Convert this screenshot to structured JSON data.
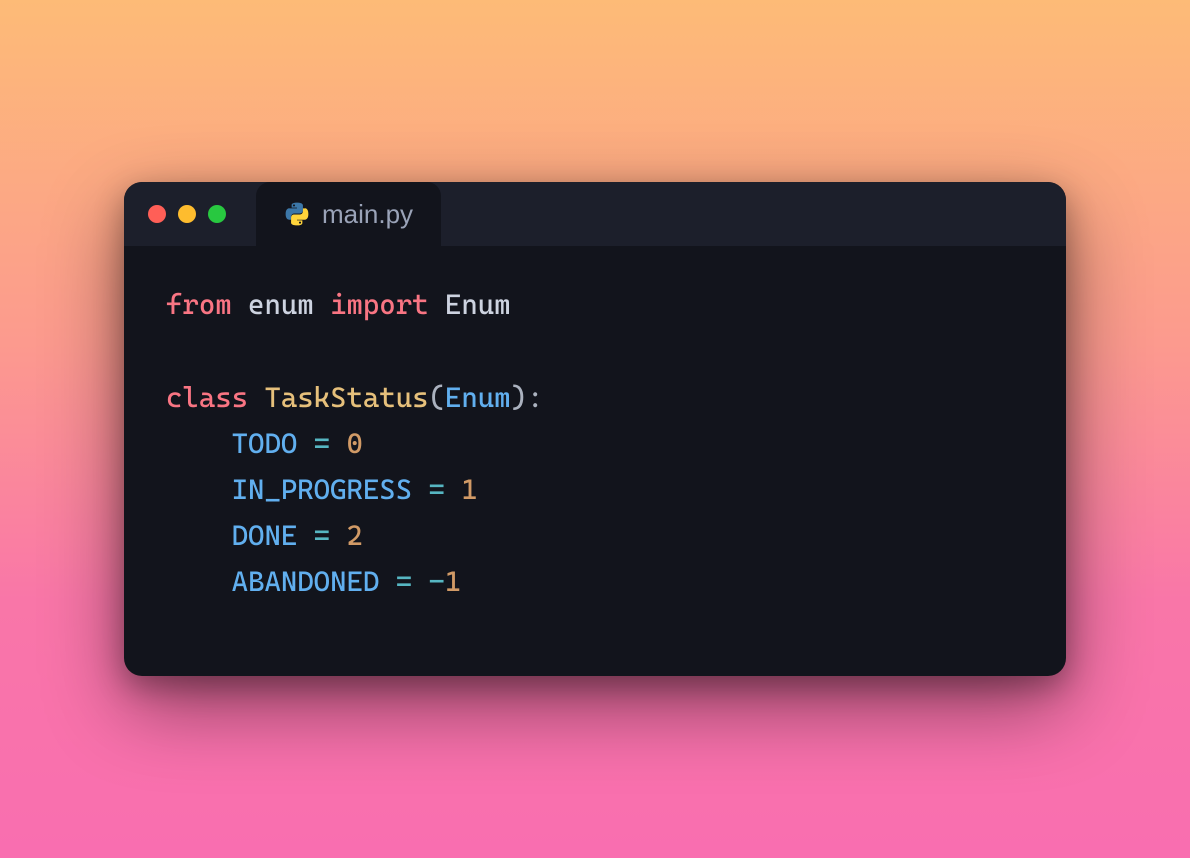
{
  "tab": {
    "filename": "main.py"
  },
  "code": {
    "kw_from": "from",
    "mod_enum": "enum",
    "kw_import": "import",
    "cls_enum": "Enum",
    "kw_class": "class",
    "cls_taskstatus": "TaskStatus",
    "paren_open": "(",
    "type_enum": "Enum",
    "paren_close": ")",
    "colon": ":",
    "indent": "    ",
    "members": {
      "todo": {
        "name": "TODO",
        "op": "=",
        "value": "0"
      },
      "in_progress": {
        "name": "IN_PROGRESS",
        "op": "=",
        "value": "1"
      },
      "done": {
        "name": "DONE",
        "op": "=",
        "value": "2"
      },
      "abandoned": {
        "name": "ABANDONED",
        "op": "=",
        "neg": "-",
        "value": "1"
      }
    }
  }
}
